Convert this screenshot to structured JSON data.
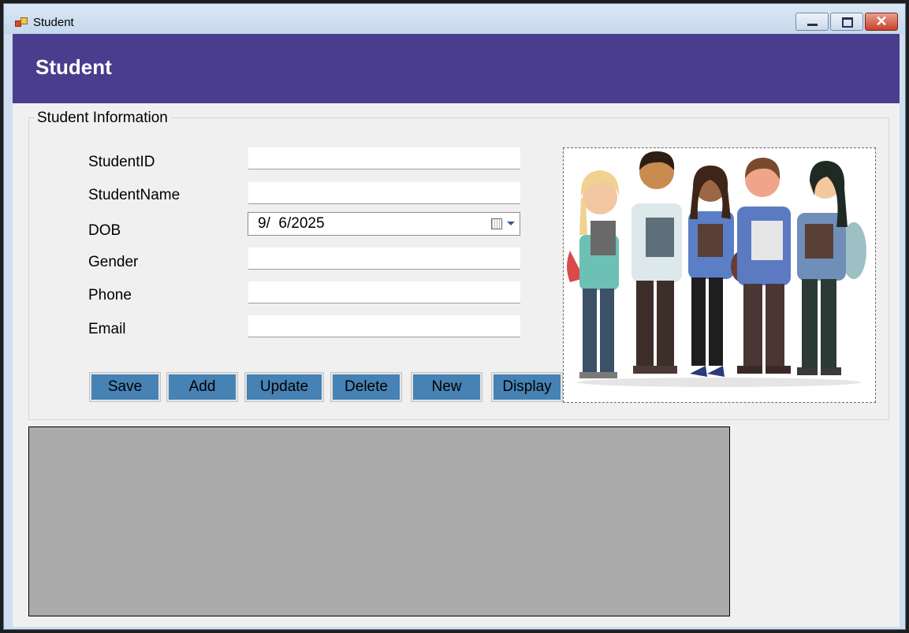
{
  "window": {
    "title": "Student",
    "controls": {
      "minimize": "minimize",
      "maximize": "maximize",
      "close": "close"
    }
  },
  "header": {
    "title": "Student"
  },
  "form": {
    "group_title": "Student Information",
    "fields": {
      "student_id": {
        "label": "StudentID",
        "value": ""
      },
      "student_name": {
        "label": "StudentName",
        "value": ""
      },
      "dob": {
        "label": "DOB",
        "value": "9/  6/2025"
      },
      "gender": {
        "label": "Gender",
        "value": ""
      },
      "phone": {
        "label": "Phone",
        "value": ""
      },
      "email": {
        "label": "Email",
        "value": ""
      }
    },
    "buttons": {
      "save": "Save",
      "add": "Add",
      "update": "Update",
      "delete": "Delete",
      "new": "New",
      "display": "Display"
    }
  },
  "picture": {
    "icon": "students-illustration"
  },
  "colors": {
    "header": "#4a3d8d",
    "button": "#4682b4",
    "grid": "#ababab"
  }
}
